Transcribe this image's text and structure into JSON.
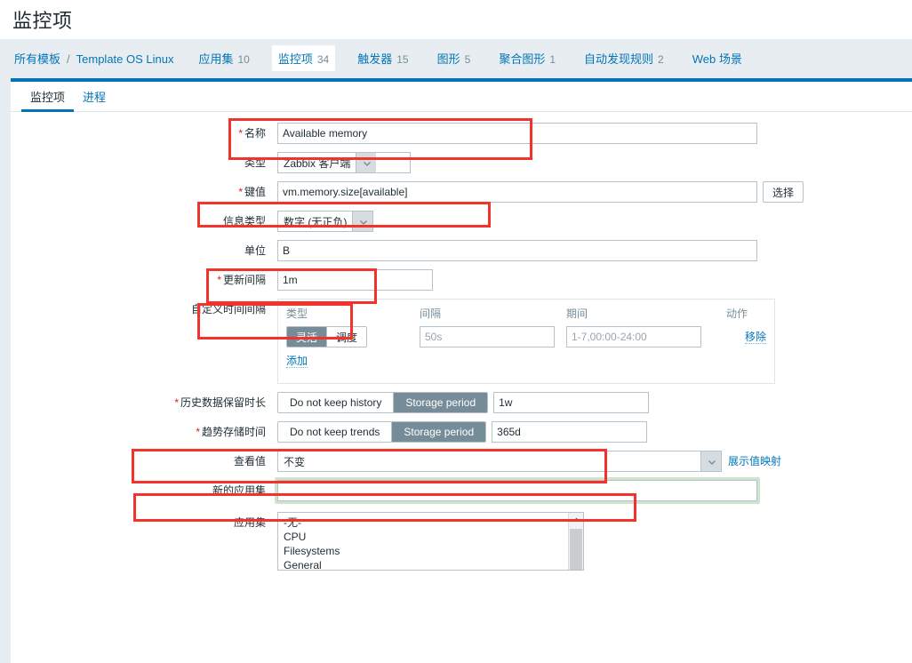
{
  "header": {
    "title": "监控项"
  },
  "breadcrumb": {
    "root": "所有模板",
    "separator": "/",
    "template": "Template OS Linux",
    "items": [
      {
        "label": "应用集",
        "count": "10",
        "active": false
      },
      {
        "label": "监控项",
        "count": "34",
        "active": true
      },
      {
        "label": "触发器",
        "count": "15",
        "active": false
      },
      {
        "label": "图形",
        "count": "5",
        "active": false
      },
      {
        "label": "聚合图形",
        "count": "1",
        "active": false
      },
      {
        "label": "自动发现规则",
        "count": "2",
        "active": false
      },
      {
        "label": "Web 场景",
        "count": "",
        "active": false
      }
    ]
  },
  "tabs": [
    {
      "label": "监控项",
      "active": true
    },
    {
      "label": "进程",
      "active": false
    }
  ],
  "form": {
    "name": {
      "label": "名称",
      "required": true,
      "value": "Available memory"
    },
    "type": {
      "label": "类型",
      "required": false,
      "value": "Zabbix 客户端"
    },
    "key": {
      "label": "键值",
      "required": true,
      "value": "vm.memory.size[available]",
      "select_button": "选择"
    },
    "info_type": {
      "label": "信息类型",
      "required": false,
      "value": "数字 (无正负)"
    },
    "units": {
      "label": "单位",
      "required": false,
      "value": "B"
    },
    "update_interval": {
      "label": "更新间隔",
      "required": true,
      "value": "1m"
    },
    "custom_intervals": {
      "label": "自定义时间间隔",
      "columns": {
        "type": "类型",
        "interval": "间隔",
        "period": "期间",
        "action": "动作"
      },
      "rows": [
        {
          "type_options": [
            {
              "label": "灵活",
              "selected": true
            },
            {
              "label": "调度",
              "selected": false
            }
          ],
          "interval_value": "",
          "interval_placeholder": "50s",
          "period_value": "",
          "period_placeholder": "1-7,00:00-24:00",
          "action": "移除"
        }
      ],
      "add_link": "添加"
    },
    "history": {
      "label": "历史数据保留时长",
      "required": true,
      "options": [
        {
          "label": "Do not keep history",
          "selected": false
        },
        {
          "label": "Storage period",
          "selected": true
        }
      ],
      "value": "1w"
    },
    "trends": {
      "label": "趋势存储时间",
      "required": true,
      "options": [
        {
          "label": "Do not keep trends",
          "selected": false
        },
        {
          "label": "Storage period",
          "selected": true
        }
      ],
      "value": "365d"
    },
    "show_value": {
      "label": "查看值",
      "required": false,
      "value": "不变",
      "link": "展示值映射"
    },
    "new_application": {
      "label": "新的应用集",
      "required": false,
      "value": "",
      "focused": true
    },
    "applications": {
      "label": "应用集",
      "options": [
        "-无-",
        "CPU",
        "Filesystems",
        "General"
      ]
    }
  },
  "colors": {
    "accent": "#0275b8",
    "annotation": "#f4322c",
    "toggle_on": "#768d99",
    "focus_green": "#cfe5cb",
    "required": "#d31f1f"
  }
}
